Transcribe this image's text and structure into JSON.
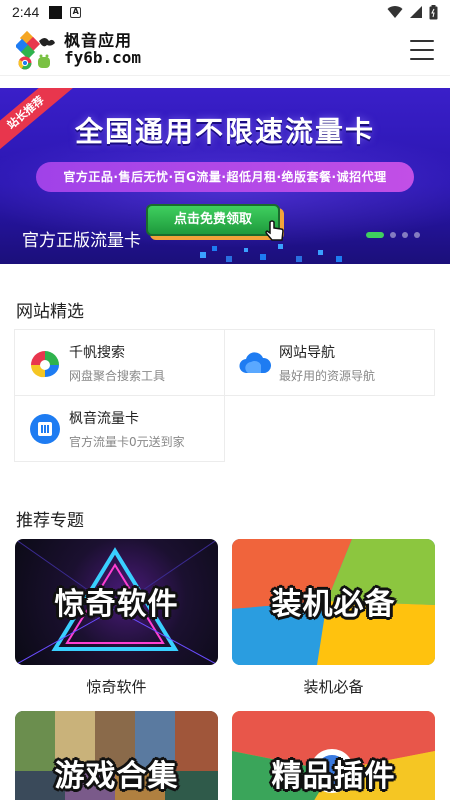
{
  "status_bar": {
    "time": "2:44"
  },
  "header": {
    "logo_cn": "枫音应用",
    "logo_en": "fy6b.com"
  },
  "banner": {
    "ribbon": "站长推荐",
    "title": "全国通用不限速流量卡",
    "pill": "官方正品·售后无忧·百G流量·超低月租·绝版套餐·诚招代理",
    "cta": "点击免费领取",
    "caption": "官方正版流量卡",
    "slide_count": 4,
    "active_slide": 1
  },
  "site_picks": {
    "title": "网站精选",
    "items": [
      {
        "name": "千帆搜索",
        "desc": "网盘聚合搜索工具",
        "icon": "qianfan-logo-icon"
      },
      {
        "name": "网站导航",
        "desc": "最好用的资源导航",
        "icon": "cloud-icon"
      },
      {
        "name": "枫音流量卡",
        "desc": "官方流量卡0元送到家",
        "icon": "sim-card-icon"
      }
    ]
  },
  "topics": {
    "title": "推荐专题",
    "cards": [
      {
        "image_text": "惊奇软件",
        "label": "惊奇软件"
      },
      {
        "image_text": "装机必备",
        "label": "装机必备"
      },
      {
        "image_text": "游戏合集",
        "label": "游戏合集"
      },
      {
        "image_text": "精品插件",
        "label": "精品插件"
      }
    ]
  },
  "colors": {
    "banner_top": "#3a1fc9",
    "pill": "#b44ae8",
    "cta_green": "#2fb34d",
    "ribbon": "#e8364d",
    "icon_blue": "#1e7cf2"
  }
}
